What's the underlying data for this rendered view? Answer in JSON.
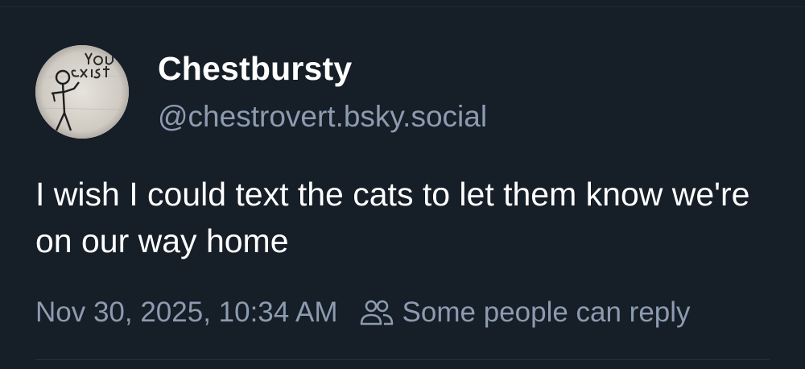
{
  "author": {
    "display_name": "Chestbursty",
    "handle": "@chestrovert.bsky.social",
    "avatar_text": "you exist"
  },
  "post": {
    "text": "I wish I could text the cats to let them know we're on our way home"
  },
  "meta": {
    "timestamp": "Nov 30, 2025, 10:34 AM",
    "reply_setting_icon": "people-icon",
    "reply_setting_label": "Some people can reply"
  },
  "colors": {
    "background": "#161e27",
    "primary_text": "#ffffff",
    "secondary_text": "#8c9bb0",
    "divider": "#26313d"
  }
}
